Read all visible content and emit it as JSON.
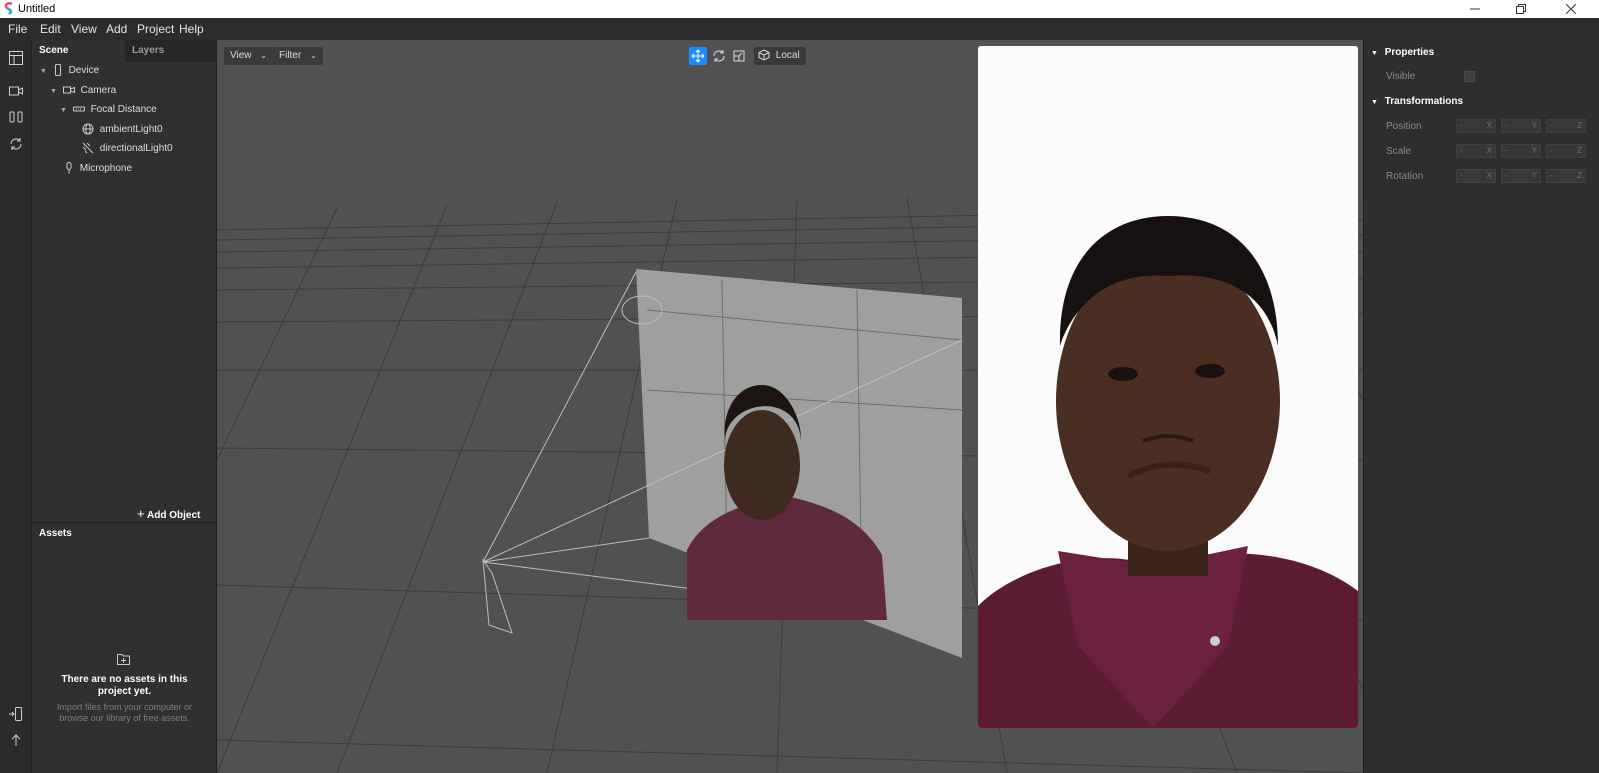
{
  "window": {
    "title": "Untitled"
  },
  "menu": [
    "File",
    "Edit",
    "View",
    "Add",
    "Project",
    "Help"
  ],
  "left_panel": {
    "tabs": [
      "Scene",
      "Layers"
    ],
    "tree": [
      {
        "label": "Device",
        "icon": "phone-icon"
      },
      {
        "label": "Camera",
        "icon": "camera-icon"
      },
      {
        "label": "Focal Distance",
        "icon": "focal-distance-icon"
      },
      {
        "label": "ambientLight0",
        "icon": "globe-icon"
      },
      {
        "label": "directionalLight0",
        "icon": "directional-light-icon"
      },
      {
        "label": "Microphone",
        "icon": "microphone-icon"
      }
    ],
    "add_object": "Add Object",
    "assets": {
      "title": "Assets",
      "empty_title": "There are no assets in this project yet.",
      "empty_desc": "Import files from your computer or browse our library of free assets."
    }
  },
  "viewport": {
    "view_button": "View",
    "filter_button": "Filter",
    "space_button": "Local",
    "active_tool": "move",
    "accent": "#1a8cff"
  },
  "properties": {
    "properties_title": "Properties",
    "visible_label": "Visible",
    "transformations_title": "Transformations",
    "rows": [
      {
        "label": "Position",
        "axes": [
          "X",
          "Y",
          "Z"
        ],
        "values": [
          "-",
          "-",
          "-"
        ]
      },
      {
        "label": "Scale",
        "axes": [
          "X",
          "Y",
          "Z"
        ],
        "values": [
          "-",
          "-",
          "-"
        ]
      },
      {
        "label": "Rotation",
        "axes": [
          "X",
          "Y",
          "Z"
        ],
        "values": [
          "-",
          "-",
          "-"
        ]
      }
    ]
  }
}
